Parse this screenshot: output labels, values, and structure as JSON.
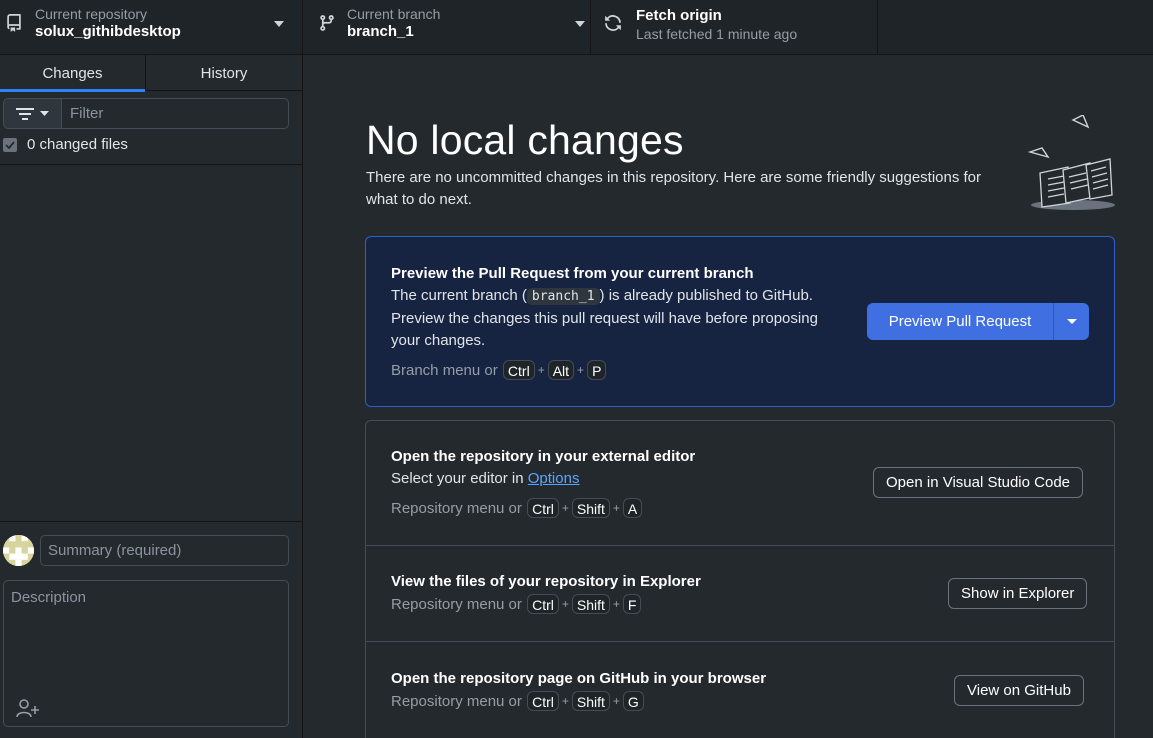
{
  "toolbar": {
    "repo": {
      "label": "Current repository",
      "value": "solux_githibdesktop"
    },
    "branch": {
      "label": "Current branch",
      "value": "branch_1"
    },
    "fetch": {
      "title": "Fetch origin",
      "subtitle": "Last fetched 1 minute ago"
    }
  },
  "sidebar": {
    "tabs": [
      {
        "label": "Changes",
        "active": true
      },
      {
        "label": "History",
        "active": false
      }
    ],
    "filter_placeholder": "Filter",
    "changed_files_label": "0 changed files",
    "summary_placeholder": "Summary (required)",
    "description_placeholder": "Description"
  },
  "main": {
    "title": "No local changes",
    "subtitle": "There are no uncommitted changes in this repository. Here are some friendly suggestions for what to do next.",
    "pr_card": {
      "heading": "Preview the Pull Request from your current branch",
      "line1_before": "The current branch (",
      "line1_code": "branch_1",
      "line1_after": ") is already published to GitHub.",
      "line2": "Preview the changes this pull request will have before proposing your changes.",
      "hint_prefix": "Branch menu or",
      "keys": [
        "Ctrl",
        "Alt",
        "P"
      ],
      "button": "Preview Pull Request"
    },
    "editor_card": {
      "heading": "Open the repository in your external editor",
      "desc_before": "Select your editor in ",
      "desc_link": "Options",
      "hint_prefix": "Repository menu or",
      "keys": [
        "Ctrl",
        "Shift",
        "A"
      ],
      "button": "Open in Visual Studio Code"
    },
    "explorer_card": {
      "heading": "View the files of your repository in Explorer",
      "hint_prefix": "Repository menu or",
      "keys": [
        "Ctrl",
        "Shift",
        "F"
      ],
      "button": "Show in Explorer"
    },
    "github_card": {
      "heading": "Open the repository page on GitHub in your browser",
      "hint_prefix": "Repository menu or",
      "keys": [
        "Ctrl",
        "Shift",
        "G"
      ],
      "button": "View on GitHub"
    }
  },
  "colors": {
    "background": "#24292e",
    "toolbar": "#1f2428",
    "accent": "#2f81f7",
    "primary_button": "#3f6fe0",
    "pr_card_bg": "#162442",
    "link": "#58a6ff"
  },
  "icons": [
    "repo-icon",
    "branch-icon",
    "sync-icon",
    "chevron-down-icon",
    "filter-icon",
    "check-icon",
    "avatar",
    "add-coauthor-icon",
    "empty-state-illustration"
  ]
}
